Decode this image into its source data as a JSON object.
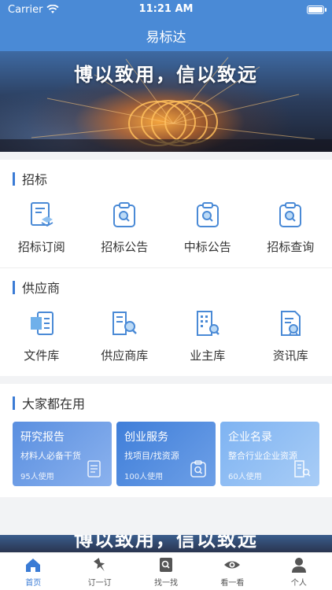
{
  "status_bar": {
    "carrier": "Carrier",
    "time": "11:21 AM"
  },
  "header": {
    "title": "易标达"
  },
  "banner": {
    "slogan": "博以致用，信以致远"
  },
  "sections": {
    "bidding": {
      "title": "招标",
      "items": [
        {
          "label": "招标订阅",
          "icon": "subscribe-doc-icon"
        },
        {
          "label": "招标公告",
          "icon": "clipboard-search-icon"
        },
        {
          "label": "中标公告",
          "icon": "clipboard-search-icon"
        },
        {
          "label": "招标查询",
          "icon": "clipboard-search-icon"
        }
      ]
    },
    "supplier": {
      "title": "供应商",
      "items": [
        {
          "label": "文件库",
          "icon": "file-library-icon"
        },
        {
          "label": "供应商库",
          "icon": "supplier-search-icon"
        },
        {
          "label": "业主库",
          "icon": "building-search-icon"
        },
        {
          "label": "资讯库",
          "icon": "news-doc-icon"
        }
      ]
    },
    "popular": {
      "title": "大家都在用",
      "cards": [
        {
          "title": "研究报告",
          "subtitle": "材料人必备干货",
          "count": "95人使用",
          "icon": "report-icon"
        },
        {
          "title": "创业服务",
          "subtitle": "找项目/找资源",
          "count": "100人使用",
          "icon": "clipboard-search-icon"
        },
        {
          "title": "企业名录",
          "subtitle": "整合行业企业资源",
          "count": "60人使用",
          "icon": "building-search-icon"
        }
      ]
    }
  },
  "tabbar": {
    "tabs": [
      {
        "label": "首页",
        "icon": "home-icon",
        "active": true
      },
      {
        "label": "订一订",
        "icon": "pin-icon",
        "active": false
      },
      {
        "label": "找一找",
        "icon": "search-book-icon",
        "active": false
      },
      {
        "label": "看一看",
        "icon": "eye-icon",
        "active": false
      },
      {
        "label": "个人",
        "icon": "person-icon",
        "active": false
      }
    ]
  },
  "colors": {
    "primary": "#4a8ad6",
    "accent": "#3a7bd5",
    "icon_blue": "#4a8ad6"
  }
}
